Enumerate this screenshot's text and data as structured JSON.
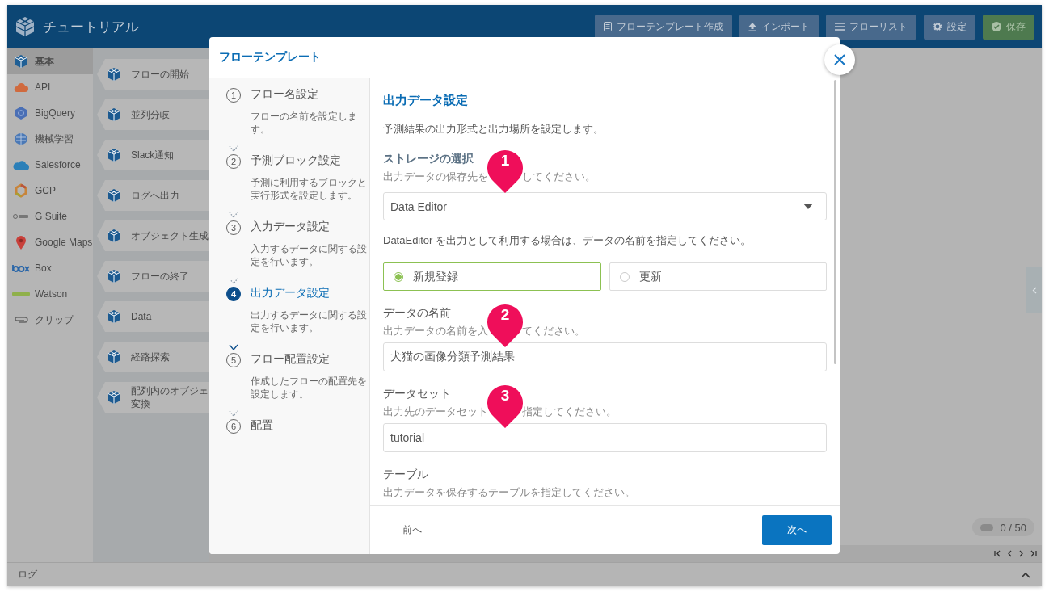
{
  "header": {
    "title": "チュートリアル",
    "buttons": [
      {
        "label": "フローテンプレート作成",
        "kind": "default"
      },
      {
        "label": "インポート",
        "kind": "default"
      },
      {
        "label": "フローリスト",
        "kind": "default"
      },
      {
        "label": "設定",
        "kind": "default"
      },
      {
        "label": "保存",
        "kind": "success"
      }
    ]
  },
  "sidebar": {
    "items": [
      {
        "label": "基本",
        "selected": true
      },
      {
        "label": "API",
        "selected": false
      },
      {
        "label": "BigQuery",
        "selected": false
      },
      {
        "label": "機械学習",
        "selected": false
      },
      {
        "label": "Salesforce",
        "selected": false
      },
      {
        "label": "GCP",
        "selected": false
      },
      {
        "label": "G Suite",
        "selected": false
      },
      {
        "label": "Google Maps",
        "selected": false
      },
      {
        "label": "Box",
        "selected": false
      },
      {
        "label": "Watson",
        "selected": false
      },
      {
        "label": "クリップ",
        "selected": false
      }
    ]
  },
  "palette": {
    "items": [
      {
        "lines": [
          "フローの開始"
        ]
      },
      {
        "lines": [
          "並列分岐"
        ]
      },
      {
        "lines": [
          "Slack通知"
        ]
      },
      {
        "lines": [
          "ログへ出力"
        ]
      },
      {
        "lines": [
          "オブジェクト生成"
        ]
      },
      {
        "lines": [
          "フローの終了"
        ]
      },
      {
        "lines": [
          "Data"
        ]
      },
      {
        "lines": [
          "経路探索"
        ]
      },
      {
        "lines": [
          "配列内のオブジェ",
          "変換"
        ]
      }
    ]
  },
  "canvas": {
    "counter": "0 / 50"
  },
  "log_bar": {
    "label": "ログ"
  },
  "modal": {
    "title": "フローテンプレート",
    "steps": [
      {
        "number": "1",
        "title": "フロー名設定",
        "description": "フローの名前を設定します。",
        "selected": false
      },
      {
        "number": "2",
        "title": "予測ブロック設定",
        "description": "予測に利用するブロックと実行形式を設定します。",
        "selected": false
      },
      {
        "number": "3",
        "title": "入力データ設定",
        "description": "入力するデータに関する設定を行います。",
        "selected": false
      },
      {
        "number": "4",
        "title": "出力データ設定",
        "description": "出力するデータに関する設定を行います。",
        "selected": true
      },
      {
        "number": "5",
        "title": "フロー配置設定",
        "description": "作成したフローの配置先を設定します。",
        "selected": false
      },
      {
        "number": "6",
        "title": "配置",
        "selected": false
      }
    ],
    "content": {
      "heading": "出力データ設定",
      "description": "予測結果の出力形式と出力場所を設定します。",
      "sections": [
        {
          "kind": "select",
          "label": "ストレージの選択",
          "hint": [
            "出力データの保存先を",
            "してください。"
          ],
          "marker": "1",
          "value": "Data Editor"
        },
        {
          "kind": "note",
          "text": "DataEditor を出力として利用する場合は、データの名前を指定してください。"
        },
        {
          "kind": "radio",
          "options": [
            {
              "label": "新規登録",
              "selected": true
            },
            {
              "label": "更新",
              "selected": false
            }
          ]
        },
        {
          "kind": "text",
          "label": "データの名前",
          "hint": [
            "出力データの名前を入",
            "てください。"
          ],
          "marker": "2",
          "value": "犬猫の画像分類予測結果"
        },
        {
          "kind": "text",
          "label": "データセット",
          "hint": [
            "出力先のデータセット",
            "指定してください。"
          ],
          "marker": "3",
          "value": "tutorial"
        },
        {
          "kind": "text",
          "label": "テーブル",
          "hint": [
            "出力データを保存するテーブルを指定してください。"
          ]
        }
      ]
    },
    "footer": {
      "back": "前へ",
      "next": "次へ"
    }
  }
}
